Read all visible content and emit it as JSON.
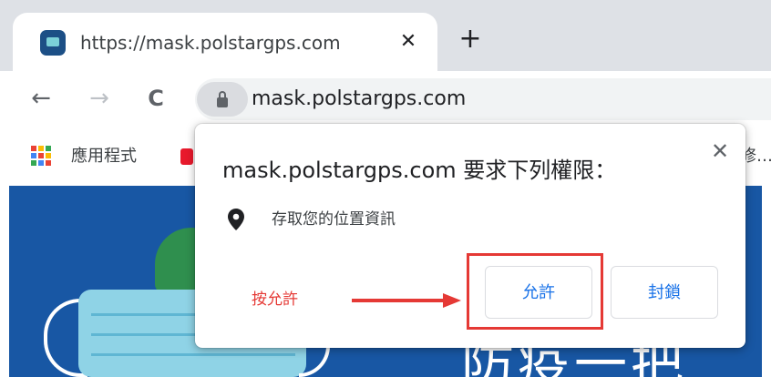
{
  "tab": {
    "title": "https://mask.polstargps.com",
    "close_glyph": "✕",
    "favicon": "site-favicon"
  },
  "newtab": {
    "glyph": "+"
  },
  "toolbar": {
    "back_glyph": "←",
    "forward_glyph": "→",
    "reload_glyph": "C"
  },
  "omnibox": {
    "url": "mask.polstargps.com",
    "icon": "lock-icon"
  },
  "bookmarks": {
    "apps_label": "應用程式",
    "right_fragment": "修…"
  },
  "apps_colors": [
    "#ea4335",
    "#fbbc05",
    "#34a853",
    "#4285f4",
    "#ea4335",
    "#fbbc05",
    "#34a853",
    "#4285f4",
    "#ea4335"
  ],
  "page": {
    "headline_fragment": "防疫一把"
  },
  "popup": {
    "title": "mask.polstargps.com 要求下列權限：",
    "close_glyph": "✕",
    "permission_icon": "location-pin-icon",
    "permission_text": "存取您的位置資訊",
    "allow_label": "允許",
    "block_label": "封鎖"
  },
  "annotation": {
    "text": "按允許",
    "color": "#e53935"
  },
  "colors": {
    "accent": "#1a73e8",
    "page_blue": "#1857a4",
    "tabstrip": "#dee1e6"
  }
}
